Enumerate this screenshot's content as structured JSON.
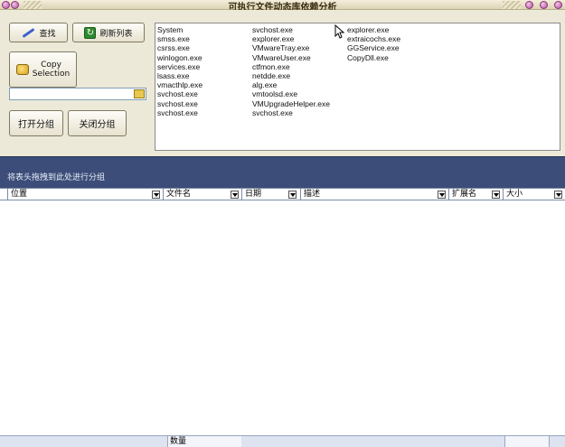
{
  "window": {
    "title": "可执行文件动态库依赖分析"
  },
  "toolbar": {
    "find_label": "查找",
    "refresh_label": "刷新列表",
    "copy_label_line1": "Copy",
    "copy_label_line2": "Selection",
    "filter_value": "",
    "open_group_label": "打开分组",
    "close_group_label": "关闭分组"
  },
  "processes": {
    "col1": [
      "System",
      "smss.exe",
      "csrss.exe",
      "winlogon.exe",
      "services.exe",
      "lsass.exe",
      "vmacthlp.exe",
      "svchost.exe",
      "svchost.exe",
      "svchost.exe"
    ],
    "col2": [
      "svchost.exe",
      "explorer.exe",
      "VMwareTray.exe",
      "VMwareUser.exe",
      "ctfmon.exe",
      "netdde.exe",
      "alg.exe",
      "vmtoolsd.exe",
      "VMUpgradeHelper.exe",
      "svchost.exe"
    ],
    "col3": [
      "explorer.exe",
      "extraicochs.exe",
      "GGService.exe",
      "CopyDll.exe"
    ]
  },
  "grid": {
    "group_hint": "将表头拖拽到此处进行分组",
    "columns": [
      "位置",
      "文件名",
      "日期",
      "描述",
      "扩展名",
      "大小"
    ]
  },
  "footer": {
    "count_label": "数量"
  }
}
